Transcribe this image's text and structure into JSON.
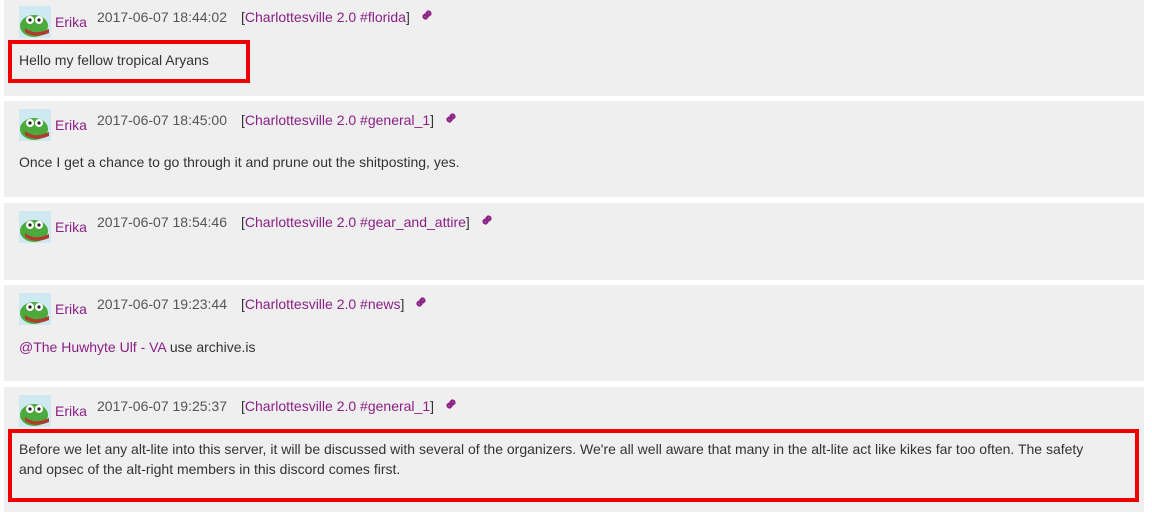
{
  "colors": {
    "accent": "#8b1f86",
    "highlight": "#ee0000",
    "card": "#efefef"
  },
  "messages": [
    {
      "avatar_icon": "frog-avatar-icon",
      "user": "Erika",
      "timestamp": "2017-06-07 18:44:02",
      "channel": "Charlottesville 2.0 #florida",
      "link_icon": "chain-link-icon",
      "text": "Hello my fellow tropical Aryans"
    },
    {
      "avatar_icon": "frog-avatar-icon",
      "user": "Erika",
      "timestamp": "2017-06-07 18:45:00",
      "channel": "Charlottesville 2.0 #general_1",
      "link_icon": "chain-link-icon",
      "text": "Once I get a chance to go through it and prune out the shitposting, yes."
    },
    {
      "avatar_icon": "frog-avatar-icon",
      "user": "Erika",
      "timestamp": "2017-06-07 18:54:46",
      "channel": "Charlottesville 2.0 #gear_and_attire",
      "link_icon": "chain-link-icon",
      "text": ""
    },
    {
      "avatar_icon": "frog-avatar-icon",
      "user": "Erika",
      "timestamp": "2017-06-07 19:23:44",
      "channel": "Charlottesville 2.0 #news",
      "link_icon": "chain-link-icon",
      "mention": "@The Huwhyte Ulf - VA",
      "text": " use archive.is"
    },
    {
      "avatar_icon": "frog-avatar-icon",
      "user": "Erika",
      "timestamp": "2017-06-07 19:25:37",
      "channel": "Charlottesville 2.0 #general_1",
      "link_icon": "chain-link-icon",
      "text_line1": "Before we let any alt-lite into this server, it will be discussed with several of the organizers. We're all well aware that many in the alt-lite act like kikes far too often. The safety",
      "text_line2": "and opsec of the alt-right members in this discord comes first."
    }
  ]
}
